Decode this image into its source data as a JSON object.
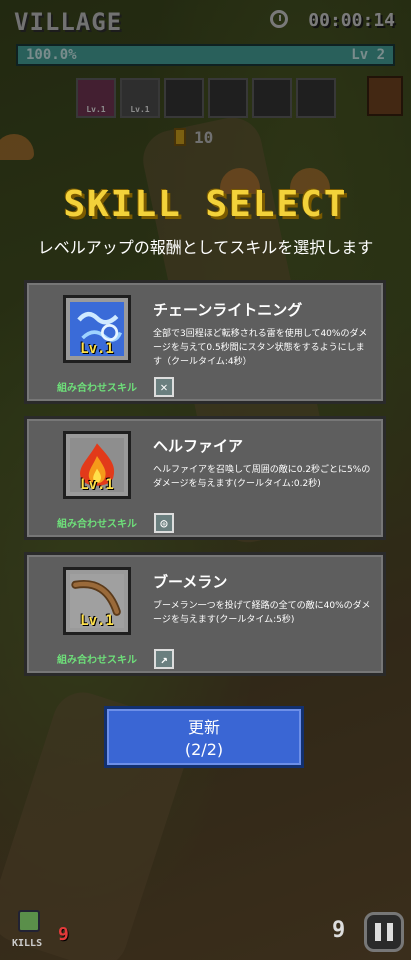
{
  "hud": {
    "stage": "VILLAGE",
    "timer": "00:00:14",
    "xp_percent": "100.0%",
    "xp_fraction": 1.0,
    "level": "Lv 2",
    "coins": "10",
    "slots": [
      {
        "label": "Lv.1",
        "icon": "fire-skill-icon"
      },
      {
        "label": "Lv.1",
        "icon": "chain-skill-icon"
      },
      {
        "label": "",
        "icon": "empty-slot"
      },
      {
        "label": "",
        "icon": "empty-slot"
      },
      {
        "label": "",
        "icon": "empty-slot"
      },
      {
        "label": "",
        "icon": "empty-slot"
      }
    ]
  },
  "dialog": {
    "title": "SKILL SELECT",
    "subtitle": "レベルアップの報酬としてスキルを選択します",
    "cards": [
      {
        "name": "チェーンライトニング",
        "level": "Lv.1",
        "mix_label": "組み合わせスキル",
        "description": "全部で3回程ほど転移される雷を使用して40%のダメージを与えて0.5秒間にスタン状態をするようにします（クールタイム:4秒）",
        "icon": "chain-lightning-icon"
      },
      {
        "name": "ヘルファイア",
        "level": "Lv.1",
        "mix_label": "組み合わせスキル",
        "description": "ヘルファイアを召喚して周囲の敵に0.2秒ごとに5%のダメージを与えます(クールタイム:0.2秒)",
        "icon": "hellfire-icon"
      },
      {
        "name": "ブーメラン",
        "level": "Lv.1",
        "mix_label": "組み合わせスキル",
        "description": "ブーメラン一つを投げて経路の全ての敵に40%のダメージを与えます(クールタイム:5秒)",
        "icon": "boomerang-icon"
      }
    ],
    "refresh_label": "更新",
    "refresh_count": "(2/2)"
  },
  "footer": {
    "kills_label": "KILLS",
    "kills": "9",
    "enemy_count": "9"
  },
  "colors": {
    "title_yellow": "#f3d23a",
    "xp_teal": "#4bb0a6",
    "refresh_blue": "#3a66d4",
    "mix_green": "#6ee07a"
  }
}
